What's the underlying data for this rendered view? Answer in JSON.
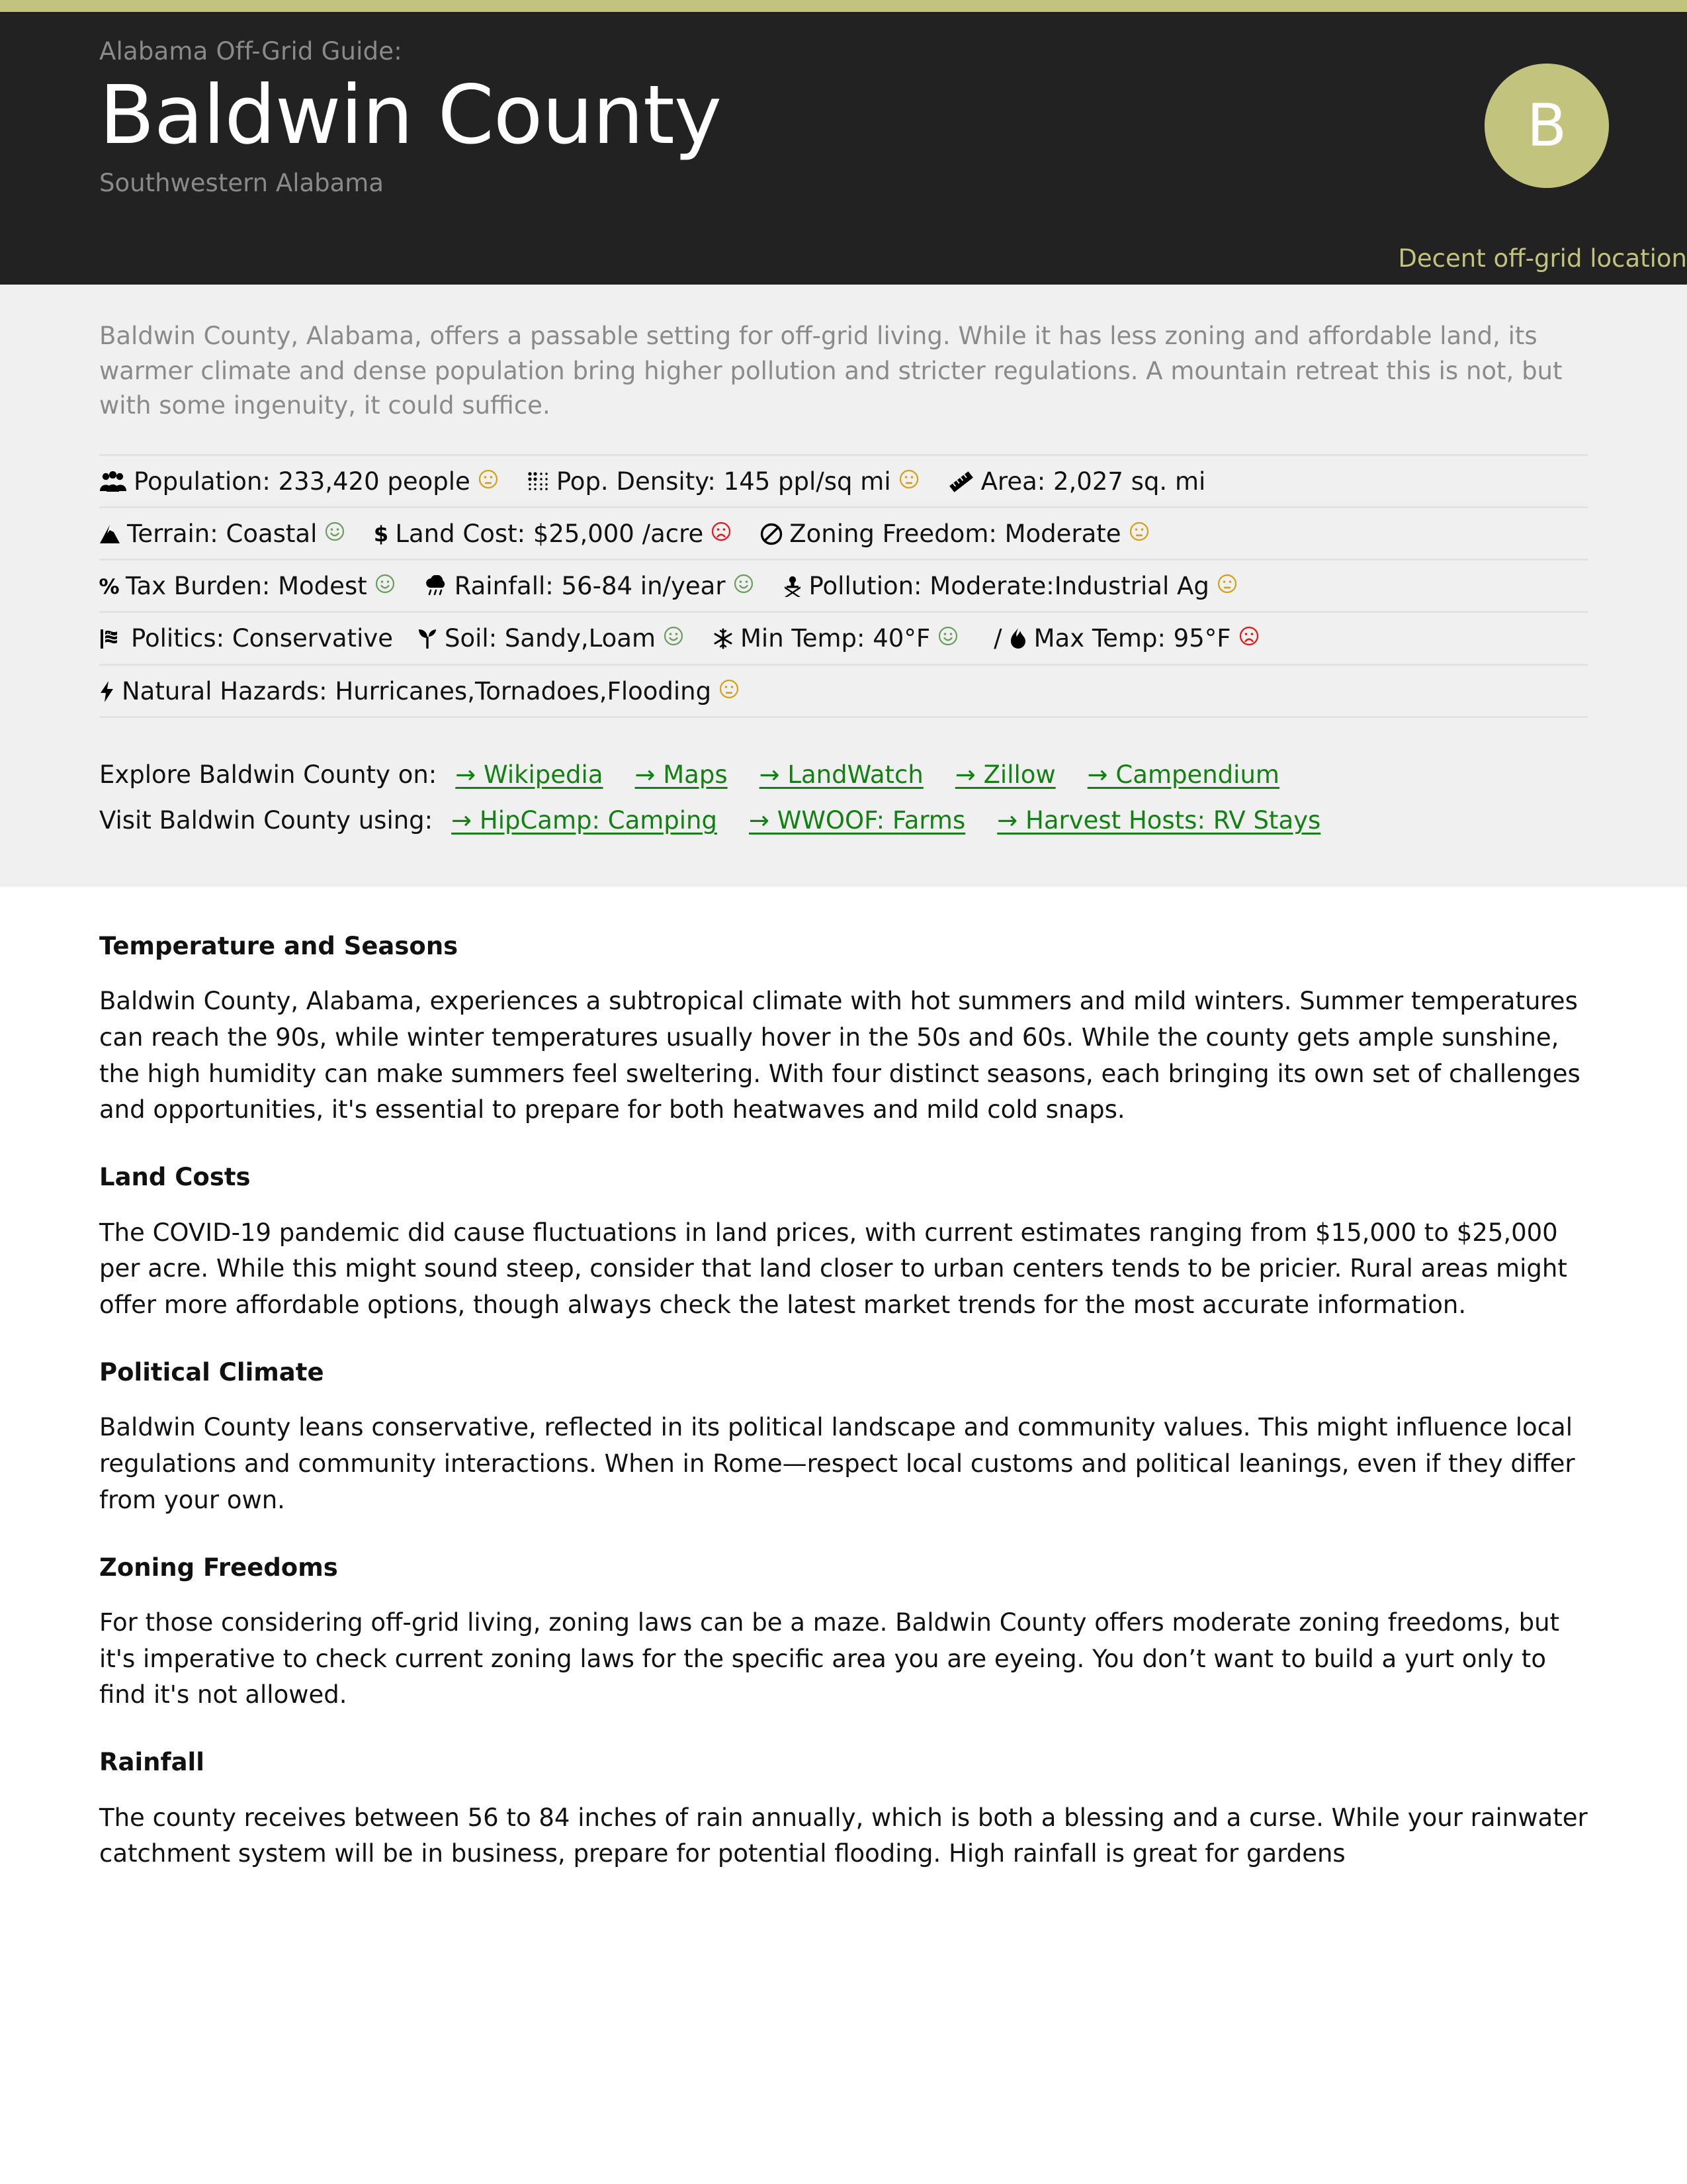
{
  "accent_color": "#c2c47e",
  "header": {
    "eyebrow": "Alabama Off-Grid Guide:",
    "title": "Baldwin County",
    "subregion": "Southwestern Alabama",
    "grade_letter": "B",
    "grade_caption": "Decent off-grid location"
  },
  "intro": "Baldwin County, Alabama, offers a passable setting for off-grid living. While it has less zoning and affordable land, its warmer climate and dense population bring higher pollution and stricter regulations. A mountain retreat this is not, but with some ingenuity, it could suffice.",
  "stats": {
    "rows": [
      [
        {
          "icon": "people-group-icon",
          "text": "Population: 233,420 people",
          "face": "neutral"
        },
        {
          "icon": "density-dots-icon",
          "text": "Pop. Density: 145 ppl/sq mi",
          "face": "neutral"
        },
        {
          "icon": "ruler-icon",
          "text": "Area: 2,027 sq. mi",
          "face": "none"
        }
      ],
      [
        {
          "icon": "mountain-icon",
          "text": "Terrain: Coastal",
          "face": "happy"
        },
        {
          "icon": "dollar-icon",
          "text": "Land Cost: $25,000 /acre",
          "face": "sad"
        },
        {
          "icon": "no-entry-icon",
          "text": "Zoning Freedom: Moderate",
          "face": "neutral"
        }
      ],
      [
        {
          "icon": "percent-icon",
          "text": "Tax Burden: Modest",
          "face": "happy"
        },
        {
          "icon": "rain-cloud-icon",
          "text": "Rainfall: 56-84 in/year",
          "face": "happy"
        },
        {
          "icon": "biohazard-skull-icon",
          "text": "Pollution: Moderate:Industrial Ag",
          "face": "neutral"
        }
      ],
      [
        {
          "icon": "flag-icon",
          "text": "Politics: Conservative",
          "face": "none"
        },
        {
          "icon": "seedling-icon",
          "text": "Soil: Sandy,Loam",
          "face": "happy"
        },
        {
          "icon": "snowflake-icon",
          "text": "Min Temp: 40°F",
          "face": "happy"
        },
        {
          "icon": "flame-icon",
          "text": "Max Temp: 95°F",
          "face": "sad",
          "sep_before": "/"
        }
      ],
      [
        {
          "icon": "bolt-icon",
          "text": "Natural Hazards: Hurricanes,Tornadoes,Flooding",
          "face": "neutral"
        }
      ]
    ]
  },
  "links": {
    "explore_label": "Explore Baldwin County on:",
    "explore_items": [
      "→ Wikipedia",
      "→ Maps",
      "→ LandWatch",
      "→ Zillow",
      "→ Campendium"
    ],
    "visit_label": "Visit Baldwin County using:",
    "visit_items": [
      "→ HipCamp: Camping",
      "→ WWOOF: Farms",
      "→ Harvest Hosts: RV Stays"
    ],
    "link_color": "#128012"
  },
  "article": {
    "sections": [
      {
        "heading": "Temperature and Seasons",
        "body": "Baldwin County, Alabama, experiences a subtropical climate with hot summers and mild winters. Summer temperatures can reach the 90s, while winter temperatures usually hover in the 50s and 60s. While the county gets ample sunshine, the high humidity can make summers feel sweltering. With four distinct seasons, each bringing its own set of challenges and opportunities, it's essential to prepare for both heatwaves and mild cold snaps."
      },
      {
        "heading": "Land Costs",
        "body": "The COVID-19 pandemic did cause fluctuations in land prices, with current estimates ranging from $15,000 to $25,000 per acre. While this might sound steep, consider that land closer to urban centers tends to be pricier. Rural areas might offer more affordable options, though always check the latest market trends for the most accurate information."
      },
      {
        "heading": "Political Climate",
        "body": "Baldwin County leans conservative, reflected in its political landscape and community values. This might influence local regulations and community interactions. When in Rome—respect local customs and political leanings, even if they differ from your own."
      },
      {
        "heading": "Zoning Freedoms",
        "body": "For those considering off-grid living, zoning laws can be a maze. Baldwin County offers moderate zoning freedoms, but it's imperative to check current zoning laws for the specific area you are eyeing. You don’t want to build a yurt only to find it's not allowed."
      },
      {
        "heading": "Rainfall",
        "body": "The county receives between 56 to 84 inches of rain annually, which is both a blessing and a curse. While your rainwater catchment system will be in business, prepare for potential flooding. High rainfall is great for gardens"
      }
    ]
  }
}
